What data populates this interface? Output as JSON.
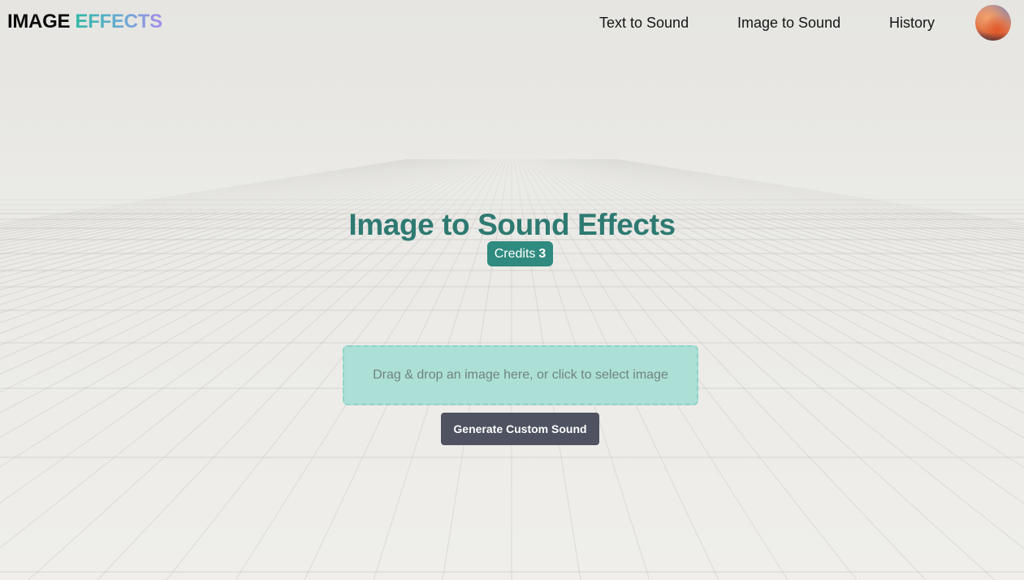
{
  "header": {
    "logo_part1": "IMAGE",
    "logo_part2": "EFFECTS",
    "nav": [
      {
        "label": "Text to Sound"
      },
      {
        "label": "Image to Sound"
      },
      {
        "label": "History"
      }
    ],
    "avatar_icon": "user-avatar-photo"
  },
  "main": {
    "title": "Image to Sound Effects",
    "credits_label": "Credits",
    "credits_value": "3",
    "dropzone_text": "Drag & drop an image here, or click to select image",
    "generate_button": "Generate Custom Sound"
  },
  "colors": {
    "title": "#2e7a72",
    "credits_badge": "#2f8a7f",
    "dropzone_fill": "#acdfd5",
    "dropzone_border": "#8fd3c7",
    "button": "#4e5261",
    "logo_gradient_start": "#2fb8a6",
    "logo_gradient_end": "#a58ee8"
  }
}
